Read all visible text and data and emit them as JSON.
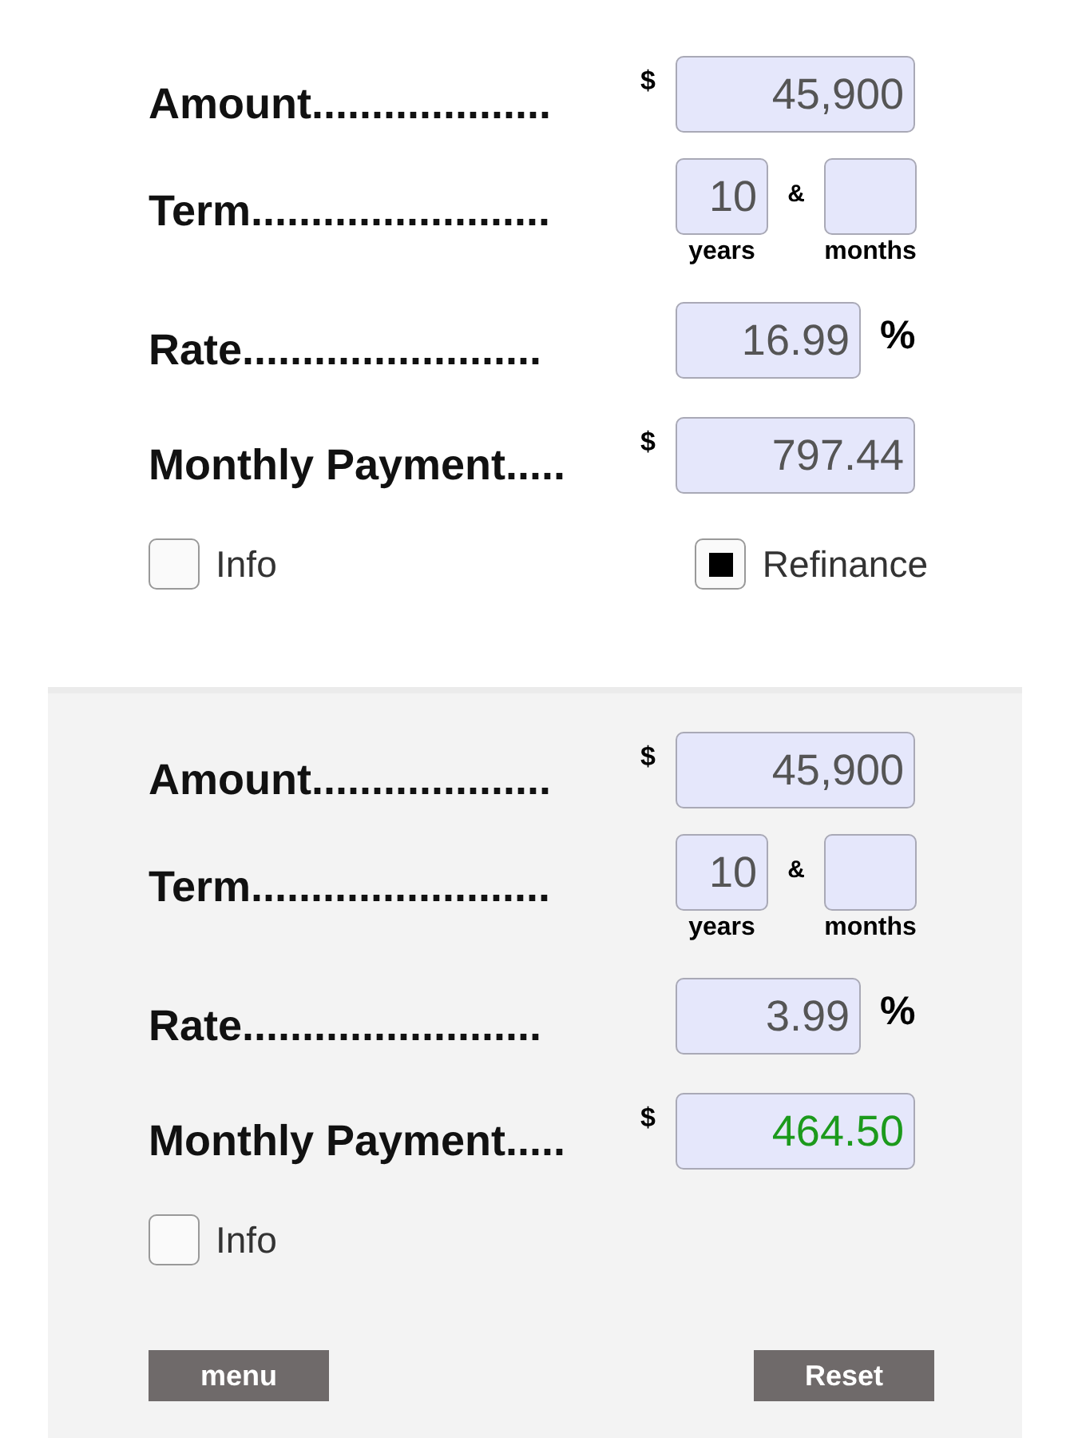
{
  "panels": [
    {
      "shaded": false,
      "amount": {
        "label": "Amount....................",
        "currency": "$",
        "value": "45,900"
      },
      "term": {
        "label": "Term.........................",
        "years": "10",
        "and_sign": "&",
        "years_label": "years",
        "months_label": "months"
      },
      "rate": {
        "label": "Rate.........................",
        "value": "16.99",
        "percent_sign": "%"
      },
      "payment": {
        "label": "Monthly Payment.....",
        "currency": "$",
        "value": "797.44",
        "highlighted": false
      },
      "checkboxes": [
        {
          "label": "Info",
          "checked": false
        },
        {
          "label": "Refinance",
          "checked": true
        }
      ]
    },
    {
      "shaded": true,
      "amount": {
        "label": "Amount....................",
        "currency": "$",
        "value": "45,900"
      },
      "term": {
        "label": "Term.........................",
        "years": "10",
        "and_sign": "&",
        "years_label": "years",
        "months_label": "months"
      },
      "rate": {
        "label": "Rate.........................",
        "value": "3.99",
        "percent_sign": "%"
      },
      "payment": {
        "label": "Monthly Payment.....",
        "currency": "$",
        "value": "464.50",
        "highlighted": true
      },
      "checkboxes": [
        {
          "label": "Info",
          "checked": false
        }
      ],
      "buttons": [
        {
          "label": "menu"
        },
        {
          "label": "Reset"
        }
      ]
    }
  ]
}
